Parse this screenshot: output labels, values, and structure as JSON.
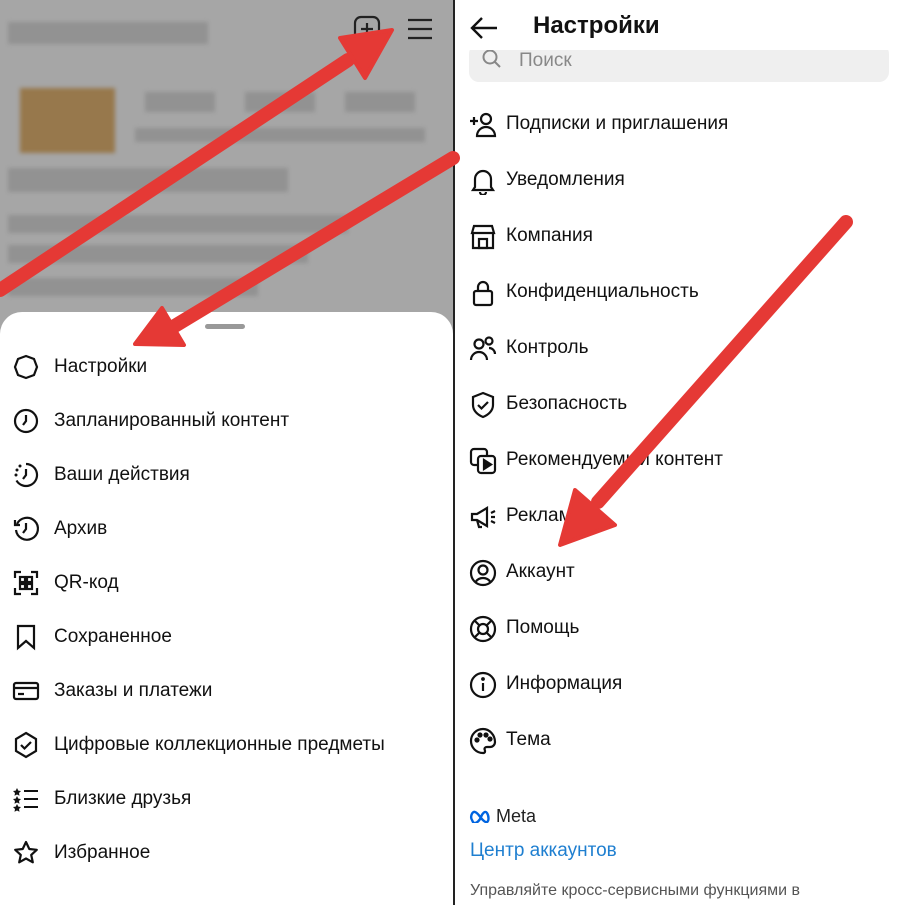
{
  "left_menu": {
    "items": [
      {
        "label": "Настройки",
        "icon": "settings-icon"
      },
      {
        "label": "Запланированный контент",
        "icon": "clock-icon"
      },
      {
        "label": "Ваши действия",
        "icon": "activity-icon"
      },
      {
        "label": "Архив",
        "icon": "archive-icon"
      },
      {
        "label": "QR-код",
        "icon": "qr-code-icon"
      },
      {
        "label": "Сохраненное",
        "icon": "bookmark-icon"
      },
      {
        "label": "Заказы и платежи",
        "icon": "card-icon"
      },
      {
        "label": "Цифровые коллекционные предметы",
        "icon": "collectibles-icon"
      },
      {
        "label": "Близкие друзья",
        "icon": "close-friends-icon"
      },
      {
        "label": "Избранное",
        "icon": "star-icon"
      }
    ]
  },
  "settings": {
    "title": "Настройки",
    "search_placeholder": "Поиск",
    "items": [
      {
        "label": "Подписки и приглашения",
        "icon": "add-person-icon"
      },
      {
        "label": "Уведомления",
        "icon": "bell-icon"
      },
      {
        "label": "Компания",
        "icon": "shop-icon"
      },
      {
        "label": "Конфиденциальность",
        "icon": "lock-icon"
      },
      {
        "label": "Контроль",
        "icon": "supervision-icon"
      },
      {
        "label": "Безопасность",
        "icon": "shield-icon"
      },
      {
        "label": "Рекомендуемый контент",
        "icon": "suggested-content-icon"
      },
      {
        "label": "Реклама",
        "icon": "megaphone-icon"
      },
      {
        "label": "Аккаунт",
        "icon": "account-icon"
      },
      {
        "label": "Помощь",
        "icon": "lifebuoy-icon"
      },
      {
        "label": "Информация",
        "icon": "info-icon"
      },
      {
        "label": "Тема",
        "icon": "palette-icon"
      }
    ],
    "meta_label": "Meta",
    "accounts_center": "Центр аккаунтов",
    "accounts_desc": "Управляйте кросс-сервисными функциями в"
  },
  "colors": {
    "arrow": "#e53935",
    "link": "#1f7fd0",
    "meta": "#0064e0"
  }
}
